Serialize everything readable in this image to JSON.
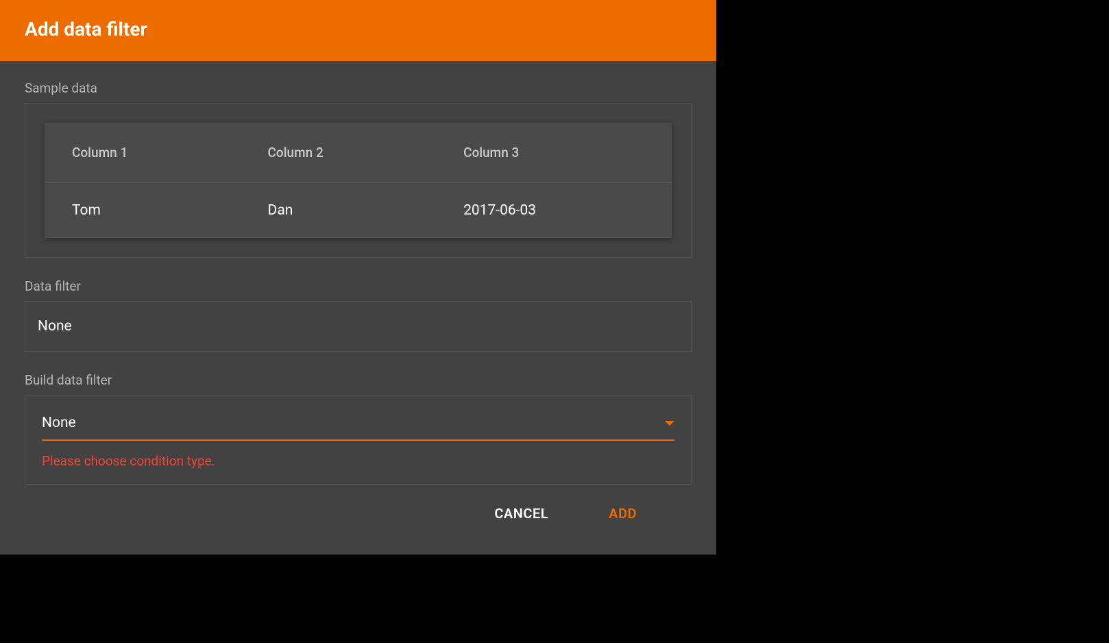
{
  "colors": {
    "accent": "#ED6C00",
    "error": "#f44336"
  },
  "dialog": {
    "title": "Add data filter"
  },
  "sections": {
    "sample_data_label": "Sample data",
    "data_filter_label": "Data filter",
    "build_data_filter_label": "Build data filter"
  },
  "sample_table": {
    "headers": [
      "Column 1",
      "Column 2",
      "Column 3"
    ],
    "rows": [
      [
        "Tom",
        "Dan",
        "2017-06-03"
      ]
    ]
  },
  "data_filter": {
    "value": "None"
  },
  "build_filter": {
    "selected": "None",
    "error": "Please choose condition type."
  },
  "footer": {
    "cancel_label": "CANCEL",
    "add_label": "ADD"
  }
}
